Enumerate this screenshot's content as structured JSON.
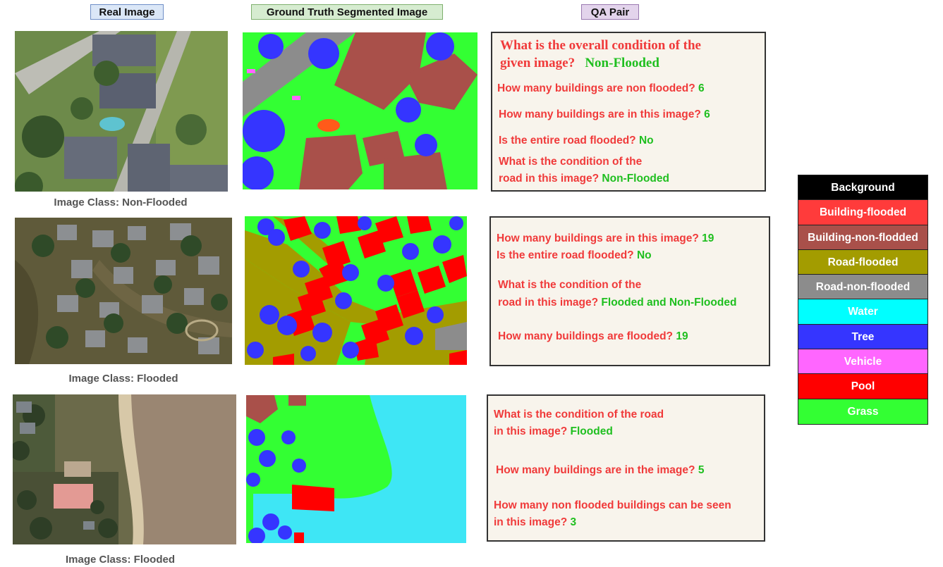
{
  "headers": {
    "real": "Real Image",
    "gt": "Ground Truth Segmented Image",
    "qa": "QA Pair"
  },
  "rows": [
    {
      "image_class": "Image Class: Non-Flooded",
      "qa": [
        {
          "q": "What is the overall condition of the",
          "a": ""
        },
        {
          "q": "given image?",
          "a": "Non-Flooded"
        },
        {
          "q": "How many buildings are non flooded?",
          "a": "6"
        },
        {
          "q": "How many buildings are in this image?",
          "a": "6"
        },
        {
          "q": "Is the entire road flooded?",
          "a": "No"
        },
        {
          "q": "What is the condition of the",
          "a": ""
        },
        {
          "q": "road in this image?",
          "a": "Non-Flooded"
        }
      ]
    },
    {
      "image_class": "Image Class: Flooded",
      "qa": [
        {
          "q": "How many buildings are in this image?",
          "a": "19"
        },
        {
          "q": "Is the entire road flooded?",
          "a": "No"
        },
        {
          "q": "What is the condition of the",
          "a": ""
        },
        {
          "q": "road in this image?",
          "a": "Flooded and Non-Flooded"
        },
        {
          "q": "How many buildings are flooded?",
          "a": "19"
        }
      ]
    },
    {
      "image_class": "Image Class: Flooded",
      "qa": [
        {
          "q": "What is the condition of the road",
          "a": ""
        },
        {
          "q": "in this image?",
          "a": "Flooded"
        },
        {
          "q": "How many buildings are in the image?",
          "a": "5"
        },
        {
          "q": "How many non flooded buildings can be seen",
          "a": ""
        },
        {
          "q": "in this image?",
          "a": "3"
        }
      ]
    }
  ],
  "legend": [
    {
      "label": "Background",
      "color": "#000000"
    },
    {
      "label": "Building-flooded",
      "color": "#ff3b3b"
    },
    {
      "label": "Building-non-flodded",
      "color": "#a9504a"
    },
    {
      "label": "Road-flooded",
      "color": "#a39c00"
    },
    {
      "label": "Road-non-flooded",
      "color": "#8c8c8c"
    },
    {
      "label": "Water",
      "color": "#00ffff"
    },
    {
      "label": "Tree",
      "color": "#3535ff"
    },
    {
      "label": "Vehicle",
      "color": "#ff66ff"
    },
    {
      "label": "Pool",
      "color": "#ff0000"
    },
    {
      "label": "Grass",
      "color": "#33ff33"
    }
  ]
}
